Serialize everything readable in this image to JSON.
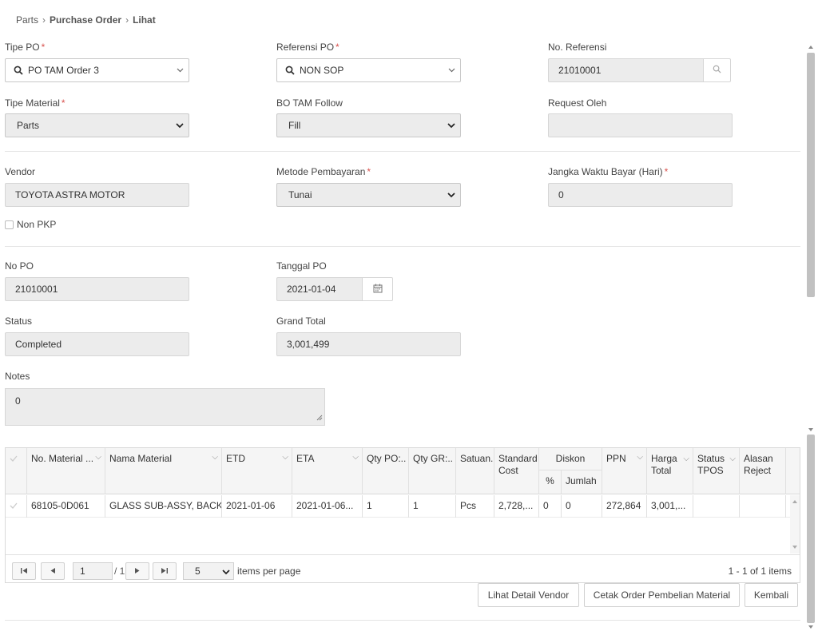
{
  "breadcrumb": {
    "items": [
      "Parts",
      "Purchase Order",
      "Lihat"
    ]
  },
  "form": {
    "tipe_po": {
      "label": "Tipe PO",
      "required": "*",
      "value": "PO TAM Order 3"
    },
    "referensi_po": {
      "label": "Referensi PO",
      "required": "*",
      "value": "NON SOP"
    },
    "no_referensi": {
      "label": "No. Referensi",
      "value": "21010001"
    },
    "tipe_material": {
      "label": "Tipe Material",
      "required": "*",
      "value": "Parts"
    },
    "bo_tam_follow": {
      "label": "BO TAM Follow",
      "value": "Fill"
    },
    "request_oleh": {
      "label": "Request Oleh",
      "value": ""
    },
    "vendor": {
      "label": "Vendor",
      "value": "TOYOTA ASTRA MOTOR"
    },
    "metode_pembayaran": {
      "label": "Metode Pembayaran",
      "required": "*",
      "value": "Tunai"
    },
    "jangka_waktu": {
      "label": "Jangka Waktu Bayar (Hari)",
      "required": "*",
      "value": "0"
    },
    "non_pkp": {
      "label": "Non PKP"
    },
    "no_po": {
      "label": "No PO",
      "value": "21010001"
    },
    "tanggal_po": {
      "label": "Tanggal PO",
      "value": "2021-01-04"
    },
    "status": {
      "label": "Status",
      "value": "Completed"
    },
    "grand_total": {
      "label": "Grand Total",
      "value": "3,001,499"
    },
    "notes": {
      "label": "Notes",
      "value": "0"
    }
  },
  "grid": {
    "headers": {
      "no_material": "No. Material ...",
      "nama_material": "Nama Material",
      "etd": "ETD",
      "eta": "ETA",
      "qty_po": "Qty PO:..",
      "qty_gr": "Qty GR:..",
      "satuan": "Satuan..",
      "standard_cost": "Standard Cost",
      "diskon": "Diskon",
      "diskon_pct": "%",
      "diskon_jumlah": "Jumlah",
      "ppn": "PPN",
      "harga_total": "Harga Total",
      "status_tpos": "Status TPOS",
      "alasan_reject": "Alasan Reject"
    },
    "rows": [
      {
        "no_material": "68105-0D061",
        "nama_material": "GLASS SUB-ASSY, BACK",
        "etd": "2021-01-06",
        "eta": "2021-01-06...",
        "qty_po": "1",
        "qty_gr": "1",
        "satuan": "Pcs",
        "standard_cost": "2,728,...",
        "diskon_pct": "0",
        "diskon_jumlah": "0",
        "ppn": "272,864",
        "harga_total": "3,001,...",
        "status_tpos": "",
        "alasan_reject": ""
      }
    ],
    "pager": {
      "page": "1",
      "of_pages": "/ 1",
      "page_size": "5",
      "items_per_page": "items per page",
      "summary": "1 - 1 of 1 items"
    }
  },
  "actions": {
    "lihat_detail_vendor": "Lihat Detail Vendor",
    "cetak_order": "Cetak Order Pembelian Material",
    "kembali": "Kembali"
  }
}
